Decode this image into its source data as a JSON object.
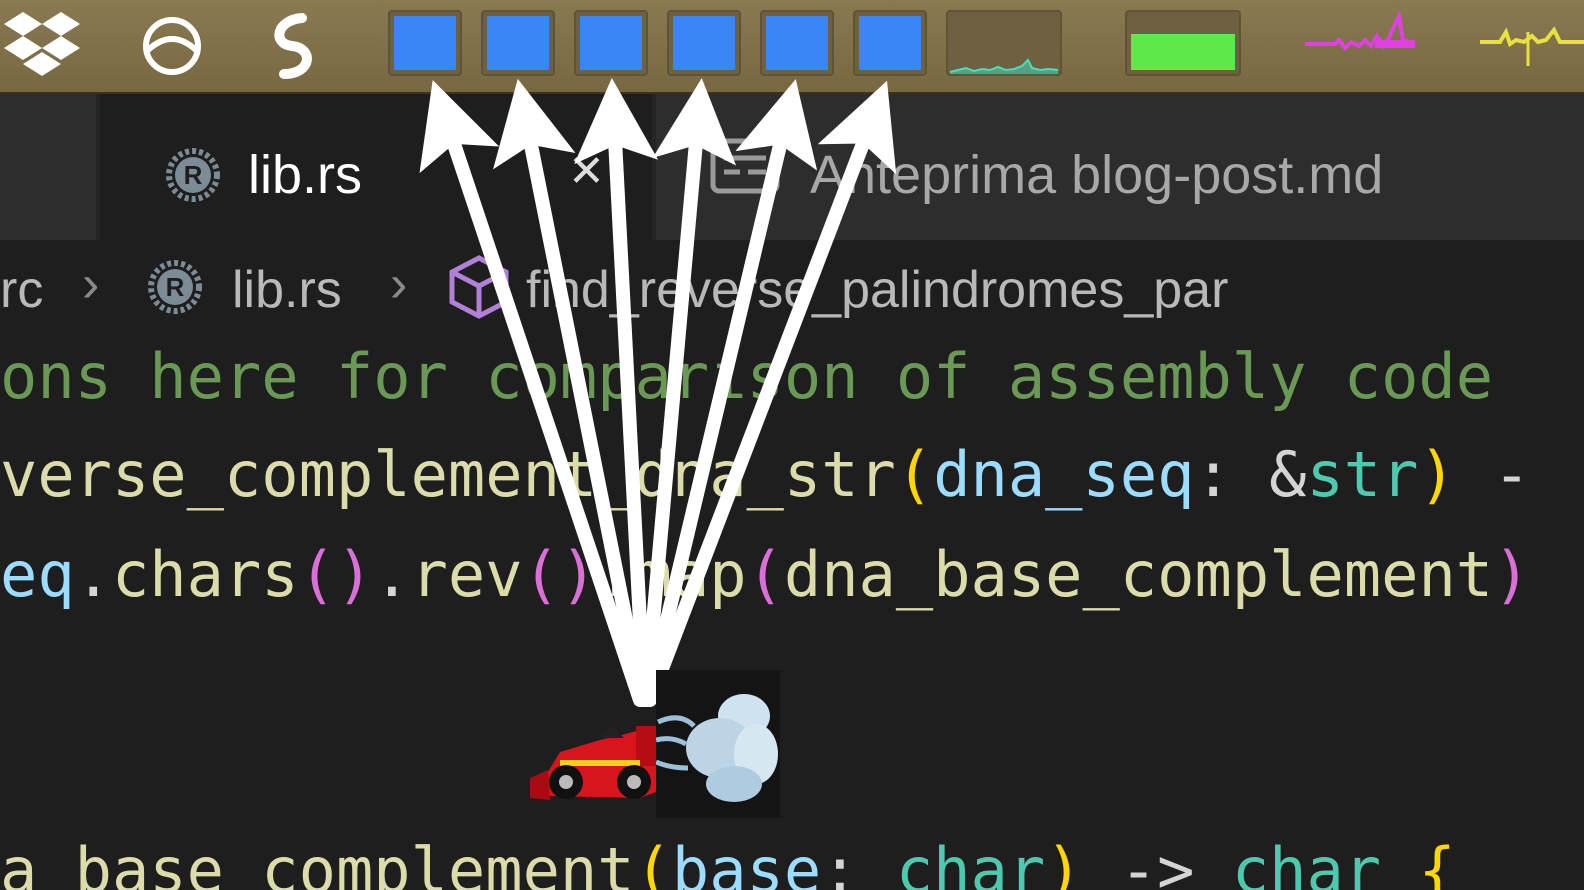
{
  "menubar": {
    "icons": [
      "dropbox-icon",
      "circle-app-icon",
      "swirl-app-icon"
    ],
    "cpu_cores": 6
  },
  "tabs": [
    {
      "label": "lib.rs",
      "active": true,
      "icon": "rust-icon",
      "close": "✕"
    },
    {
      "label": "Anteprima blog-post.md",
      "active": false,
      "icon": "preview-icon"
    }
  ],
  "breadcrumb": {
    "folder": "rc",
    "file": "lib.rs",
    "symbol": "find_reverse_palindromes_par",
    "separator": "›"
  },
  "code": {
    "line1": "ons here for comparison of assembly code",
    "line2_fn": "verse_complement_dna_str",
    "line2_paren_open": "(",
    "line2_param": "dna_seq",
    "line2_colon": ": &",
    "line2_type": "str",
    "line2_paren_close": ")",
    "line2_tail": " -",
    "line3_var": "eq",
    "line3_dot1": ".",
    "line3_chars": "chars",
    "line3_p1": "()",
    "line3_dot2": ".",
    "line3_rev": "rev",
    "line3_p2": "()",
    "line3_dot3": ".",
    "line3_map": "map",
    "line3_p3": "(",
    "line3_arg": "dna_base_complement",
    "line3_p4": ")",
    "line5_fn": "a_base_complement",
    "line5_p1": "(",
    "line5_param": "base",
    "line5_colon": ": ",
    "line5_type": "char",
    "line5_p2": ")",
    "line5_arrow": " -> ",
    "line5_ret": "char",
    "line5_brace": " {"
  },
  "colors": {
    "cpu_fill": "#3a86f6",
    "gpu_fill": "#5ee84a",
    "net_graph": "#46e0c0",
    "spark_magenta": "#e040e0",
    "spark_yellow": "#e6e040",
    "arrow": "#ffffff"
  }
}
